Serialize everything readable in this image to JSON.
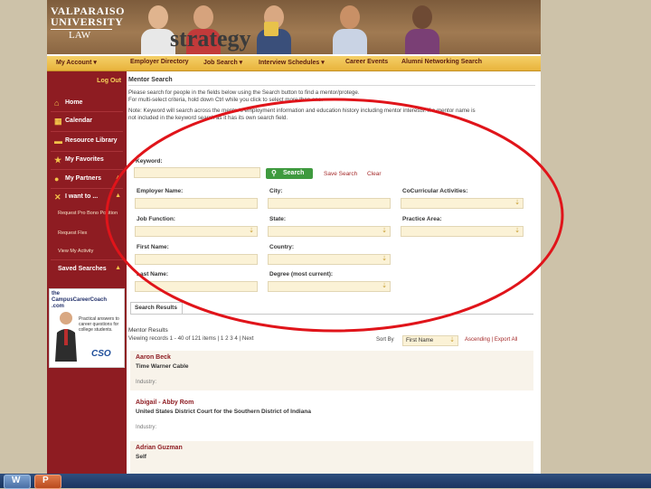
{
  "header": {
    "logo_line1": "VALPARAISO",
    "logo_line2": "UNIVERSITY",
    "logo_line3": "LAW",
    "brand": "strategy"
  },
  "topnav": {
    "items": [
      "My Account ▾",
      "Employer Directory",
      "Job Search ▾",
      "Interview Schedules ▾",
      "Career Events",
      "Alumni Networking Search"
    ]
  },
  "sidebar": {
    "logout": "Log Out",
    "items": [
      {
        "label": "Home",
        "icon": "home-icon"
      },
      {
        "label": "Calendar",
        "icon": "calendar-icon"
      },
      {
        "label": "Resource Library",
        "icon": "folder-icon"
      },
      {
        "label": "My Favorites",
        "icon": "star-icon"
      },
      {
        "label": "My Partners",
        "icon": "person-icon"
      },
      {
        "label": "I want to ...",
        "icon": "tools-icon"
      }
    ],
    "subitems": [
      "Request Pro Bono Position",
      "Request Flex",
      "View My Activity"
    ],
    "saved_searches": "Saved Searches",
    "ad": {
      "title_line1": "the",
      "title_line2": "CampusCareerCoach",
      "title_line3": ".com",
      "text": "Practical answers to career questions for college students.",
      "sponsor": "CSO"
    }
  },
  "content": {
    "page_title": "Mentor Search",
    "instructions_1": "Please search for people in the fields below using the Search button to find a mentor/protege.",
    "instructions_2": "For multi-select criteria, hold down Ctrl while you click to select more than one.",
    "note_1": "Note: Keyword will search across the mentor's employment information and education history including mentor interests. If a mentor name is",
    "note_2": "not included in the keyword search as it has its own search field.",
    "form": {
      "keyword_label": "Keyword:",
      "search_button": "Search",
      "save_search": "Save Search",
      "clear": "Clear",
      "employer_name": "Employer Name:",
      "city": "City:",
      "cocurricular": "CoCurricular Activities:",
      "job_function": "Job Function:",
      "state": "State:",
      "practice_area": "Practice Area:",
      "first_name": "First Name:",
      "country": "Country:",
      "last_name": "Last Name:",
      "degree": "Degree (most current):"
    },
    "tab": "Search Results",
    "results_title": "Mentor Results",
    "results_view": "Viewing records 1 - 40 of 121 items | 1 2 3 4 | Next",
    "sort_label": "Sort By",
    "sort_value": "First Name",
    "sort_links": "Ascending | Export All",
    "rows": [
      {
        "name": "Aaron Beck",
        "company": "Time Warner Cable",
        "industry": "Industry:"
      },
      {
        "name": "Abigail - Abby Rom",
        "company": "United States District Court for the Southern District of Indiana",
        "industry": "Industry:"
      },
      {
        "name": "Adrian Guzman",
        "company": "Self",
        "industry": ""
      }
    ]
  },
  "colors": {
    "sidebar": "#8e1c22",
    "nav": "#e8b33c",
    "accent_green": "#3f9a3f",
    "annotation": "#e0141a"
  },
  "taskbar": {
    "buttons": [
      "W",
      "P"
    ]
  }
}
